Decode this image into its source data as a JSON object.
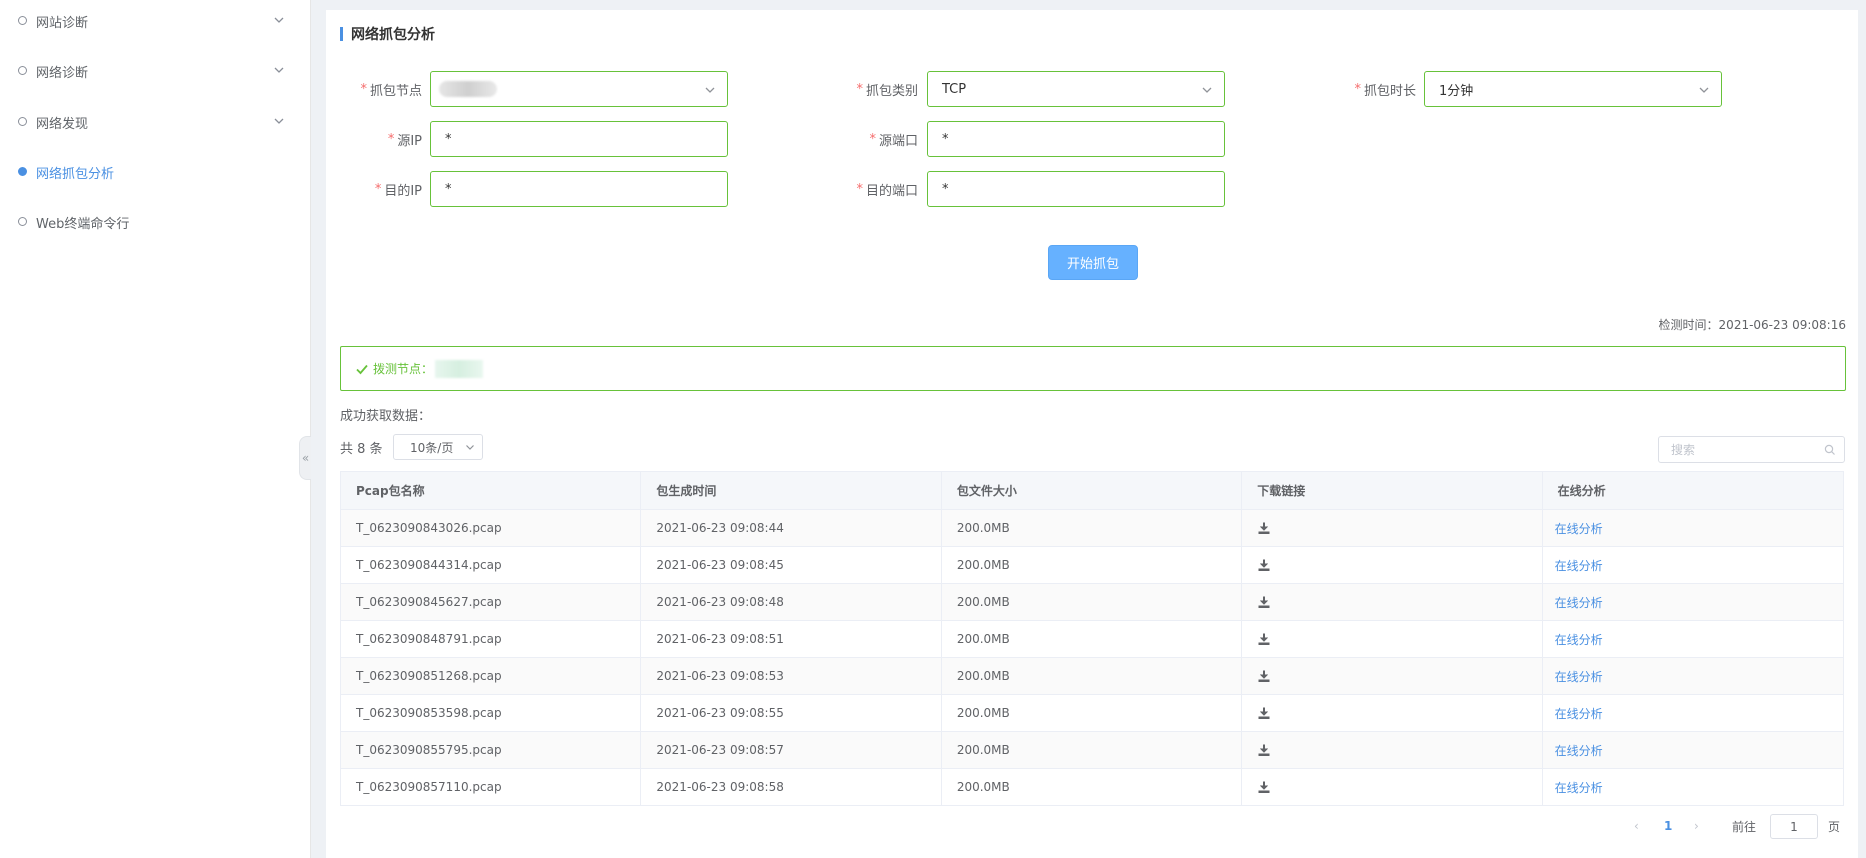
{
  "sidebar": {
    "items": [
      {
        "label": "网站诊断",
        "has_chevron": true,
        "active": false
      },
      {
        "label": "网络诊断",
        "has_chevron": true,
        "active": false
      },
      {
        "label": "网络发现",
        "has_chevron": true,
        "active": false
      },
      {
        "label": "网络抓包分析",
        "has_chevron": false,
        "active": true
      },
      {
        "label": "Web终端命令行",
        "has_chevron": false,
        "active": false
      }
    ],
    "collapse_glyph": "«"
  },
  "main": {
    "title": "网络抓包分析",
    "form": {
      "node_label": "抓包节点",
      "type_label": "抓包类别",
      "type_value": "TCP",
      "duration_label": "抓包时长",
      "duration_value": "1分钟",
      "src_ip_label": "源IP",
      "src_ip_value": "*",
      "src_port_label": "源端口",
      "src_port_value": "*",
      "dst_ip_label": "目的IP",
      "dst_ip_value": "*",
      "dst_port_label": "目的端口",
      "dst_port_value": "*",
      "required_mark": "*"
    },
    "start_button": "开始抓包",
    "detect_time": "检测时间：2021-06-23 09:08:16",
    "probe_node_label": "拨测节点：",
    "success_label": "成功获取数据：",
    "total_label": "共 8 条",
    "page_size": "10条/页",
    "search_placeholder": "搜索",
    "table": {
      "headers": [
        "Pcap包名称",
        "包生成时间",
        "包文件大小",
        "下载链接",
        "在线分析"
      ],
      "rows": [
        {
          "name": "T_0623090843026.pcap",
          "time": "2021-06-23 09:08:44",
          "size": "200.0MB",
          "analyze": "在线分析"
        },
        {
          "name": "T_0623090844314.pcap",
          "time": "2021-06-23 09:08:45",
          "size": "200.0MB",
          "analyze": "在线分析"
        },
        {
          "name": "T_0623090845627.pcap",
          "time": "2021-06-23 09:08:48",
          "size": "200.0MB",
          "analyze": "在线分析"
        },
        {
          "name": "T_0623090848791.pcap",
          "time": "2021-06-23 09:08:51",
          "size": "200.0MB",
          "analyze": "在线分析"
        },
        {
          "name": "T_0623090851268.pcap",
          "time": "2021-06-23 09:08:53",
          "size": "200.0MB",
          "analyze": "在线分析"
        },
        {
          "name": "T_0623090853598.pcap",
          "time": "2021-06-23 09:08:55",
          "size": "200.0MB",
          "analyze": "在线分析"
        },
        {
          "name": "T_0623090855795.pcap",
          "time": "2021-06-23 09:08:57",
          "size": "200.0MB",
          "analyze": "在线分析"
        },
        {
          "name": "T_0623090857110.pcap",
          "time": "2021-06-23 09:08:58",
          "size": "200.0MB",
          "analyze": "在线分析"
        }
      ]
    },
    "pagination": {
      "prev": "‹",
      "current": "1",
      "next": "›",
      "goto_label": "前往",
      "goto_value": "1",
      "page_suffix": "页"
    }
  },
  "colors": {
    "accent": "#4a90e2",
    "success": "#67c23a",
    "required": "#f56c6c",
    "button": "#66b1ff"
  }
}
